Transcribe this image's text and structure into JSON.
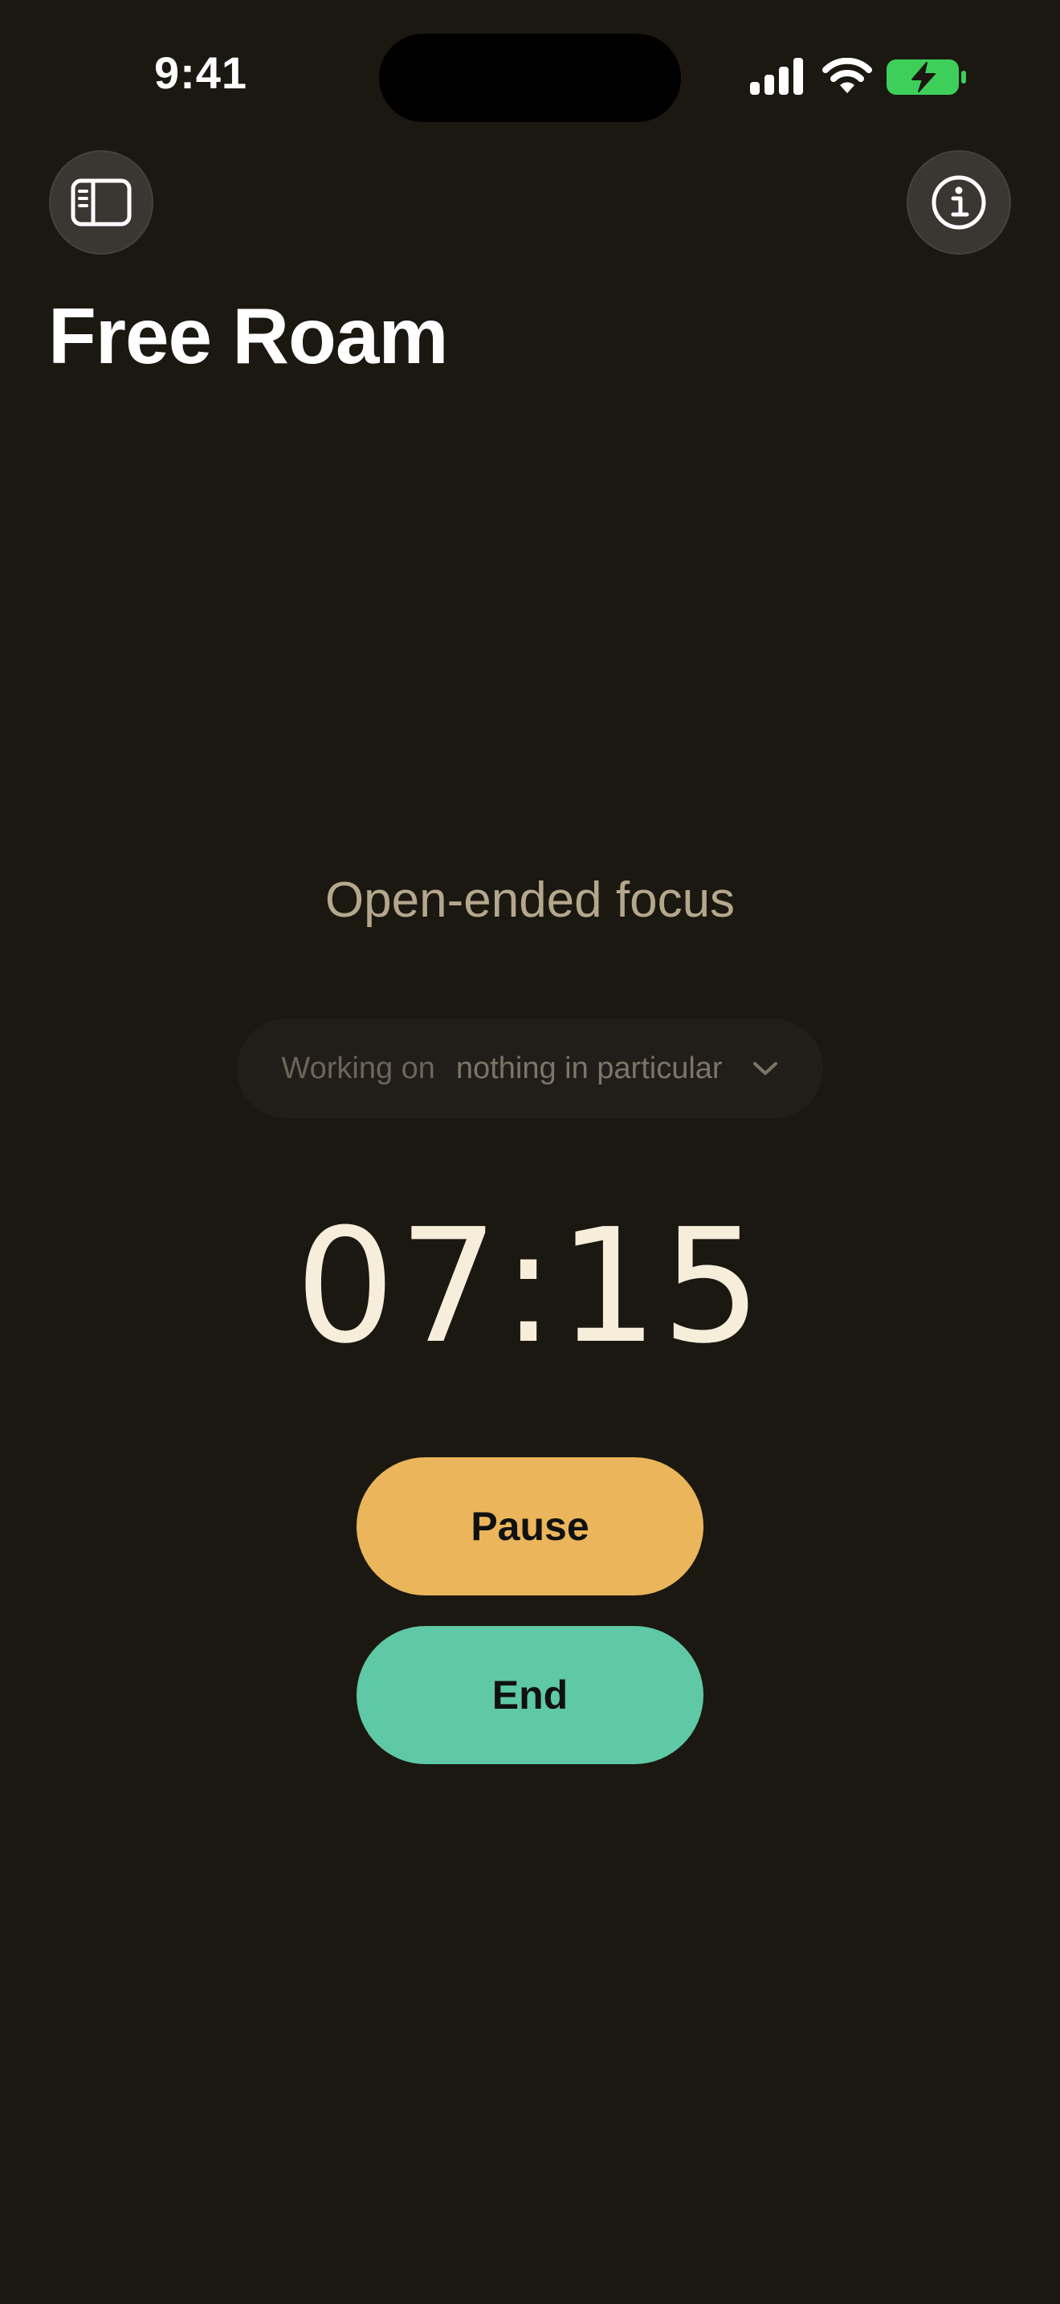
{
  "status_bar": {
    "time": "9:41",
    "icons": [
      "cellular-signal-icon",
      "wifi-icon",
      "battery-charging-icon"
    ],
    "battery_color": "#3ecf5b"
  },
  "header": {
    "left_button_icon": "sidebar-icon",
    "right_button_icon": "info-icon",
    "title": "Free Roam"
  },
  "session": {
    "subtitle": "Open-ended focus",
    "working_on_label": "Working on",
    "working_on_value": "nothing in particular",
    "dropdown_icon": "chevron-down-icon",
    "timer": "07:15"
  },
  "actions": {
    "pause_label": "Pause",
    "end_label": "End"
  },
  "colors": {
    "background": "#1b1812",
    "pause": "#ebb55b",
    "end": "#5ec9a4",
    "subtitle": "#b5a78c",
    "timer": "#f6eedb"
  }
}
